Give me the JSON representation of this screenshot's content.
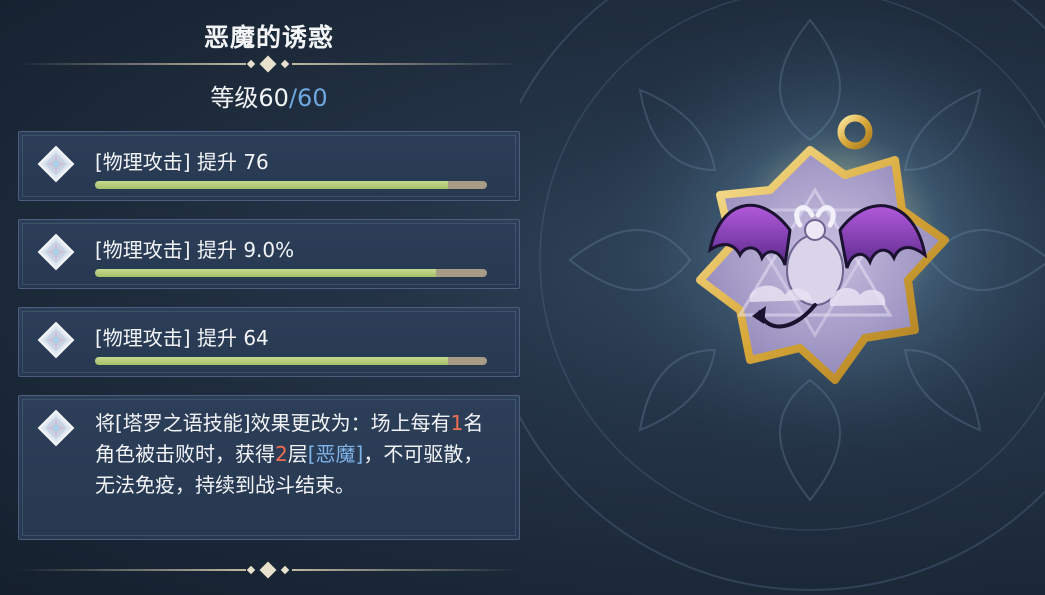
{
  "item": {
    "title": "恶魔的诱惑",
    "level_label": "等级",
    "level_current": "60",
    "level_separator": "/",
    "level_max": "60"
  },
  "stats": [
    {
      "label": "[物理攻击] 提升 76",
      "progress": 0.9
    },
    {
      "label": "[物理攻击] 提升 9.0%",
      "progress": 0.87
    },
    {
      "label": "[物理攻击] 提升 64",
      "progress": 0.9
    }
  ],
  "effect": {
    "p1": "将[塔罗之语技能]效果更改为：场上每有",
    "n1": "1",
    "p2": "名角色被击败时，获得",
    "n2": "2",
    "p3": "层",
    "tag": "[恶魔]",
    "p4": "，不可驱散，无法免疫，持续到战斗结束。"
  },
  "colors": {
    "accent_blue": "#6fa7de",
    "highlight_number": "#ef6f50",
    "bar_fill": "#b4ca7a",
    "bar_track": "#a89c86"
  },
  "icons": {
    "stat": "diamond-star-icon",
    "amulet": "demon-amulet-icon"
  }
}
